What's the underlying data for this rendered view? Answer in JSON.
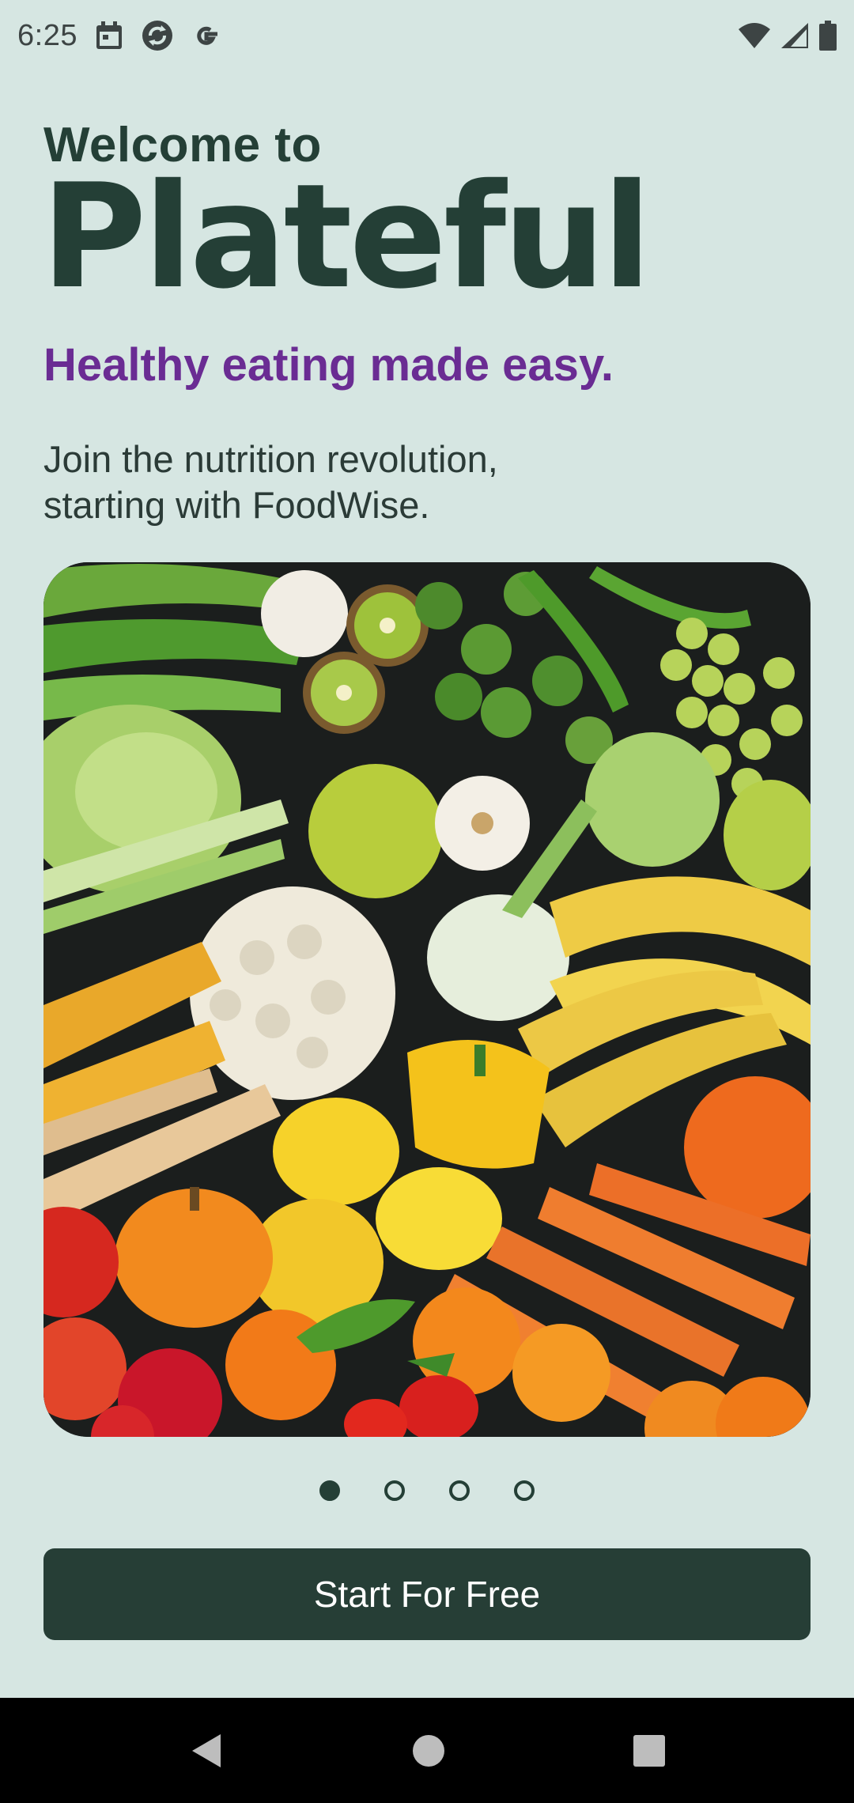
{
  "status_bar": {
    "time": "6:25",
    "left_icons": [
      "calendar-icon",
      "sync-icon",
      "google-icon"
    ],
    "right_icons": [
      "wifi-icon",
      "signal-icon",
      "battery-icon"
    ]
  },
  "onboarding": {
    "welcome": "Welcome to",
    "brand": "Plateful",
    "tagline": "Healthy eating made easy.",
    "intro_line1": "Join the nutrition revolution,",
    "intro_line2": "starting with FoodWise.",
    "hero_image": "fresh-fruits-and-vegetables-image",
    "page_indicator": {
      "total": 4,
      "current": 1
    },
    "cta_label": "Start For Free"
  },
  "nav_bar": {
    "buttons": [
      "back-icon",
      "home-icon",
      "recents-icon"
    ]
  },
  "colors": {
    "background": "#d6e6e2",
    "brand_dark": "#243f36",
    "tagline_purple": "#6a2c93",
    "button": "#263e36"
  }
}
